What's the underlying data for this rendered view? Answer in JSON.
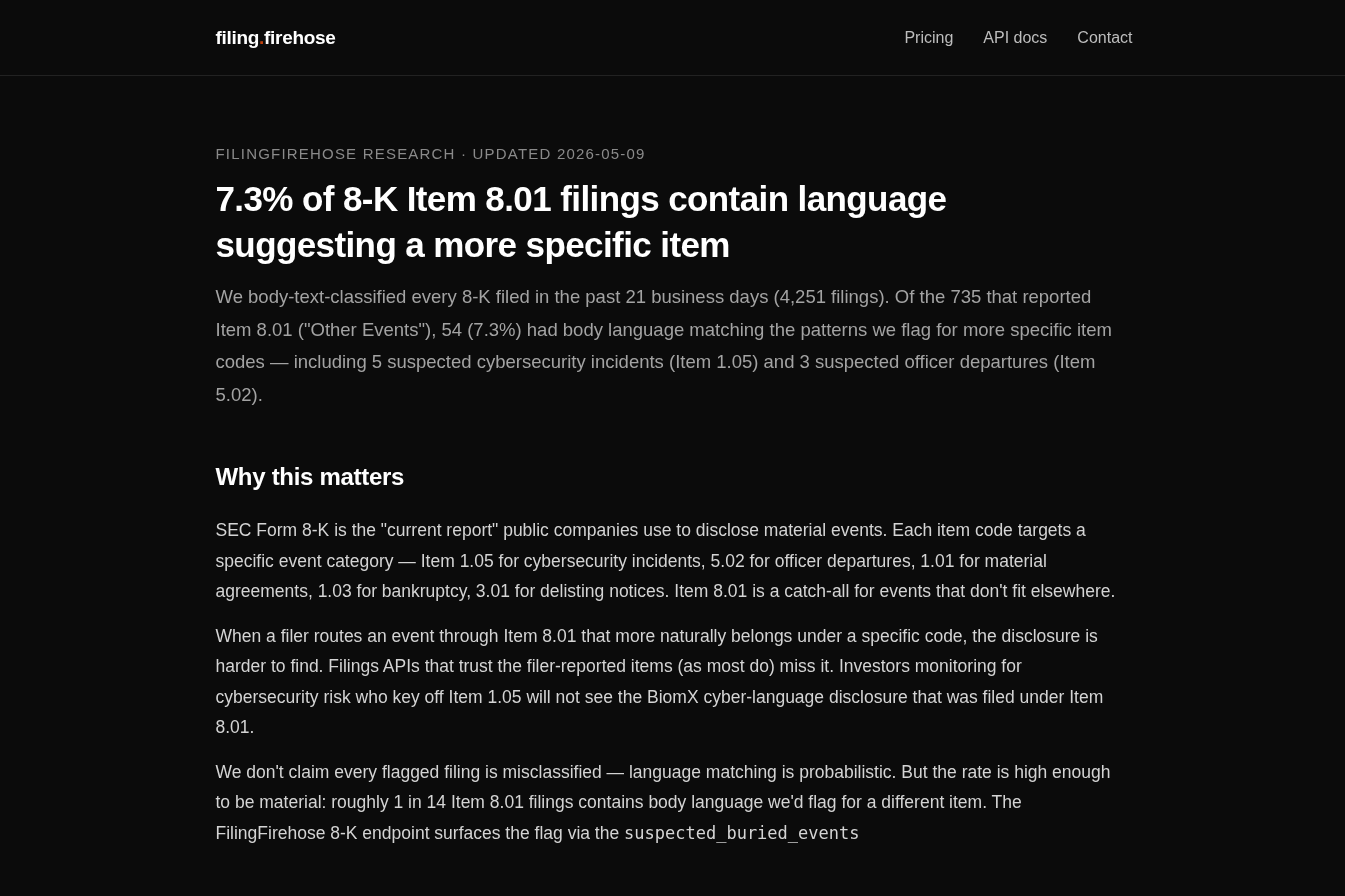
{
  "header": {
    "logo": {
      "first": "filing",
      "dot": ".",
      "last": "firehose"
    },
    "nav": [
      "Pricing",
      "API docs",
      "Contact"
    ]
  },
  "article": {
    "meta": "FILINGFIREHOSE RESEARCH · UPDATED 2026-05-09",
    "title": "7.3% of 8-K Item 8.01 filings contain language suggesting a more specific item",
    "lede": "We body-text-classified every 8-K filed in the past 21 business days (4,251 filings). Of the 735 that reported Item 8.01 (\"Other Events\"), 54 (7.3%) had body language matching the patterns we flag for more specific item codes — including 5 suspected cybersecurity incidents (Item 1.05) and 3 suspected officer departures (Item 5.02).",
    "section_heading": "Why this matters",
    "paragraphs": [
      [
        {
          "kind": "text",
          "text": "SEC Form 8-K is the \"current report\" public companies use to disclose material events. Each item code targets a specific event category — Item 1.05 for cybersecurity incidents, 5.02 for officer departures, 1.01 for material agreements, 1.03 for bankruptcy, 3.01 for delisting notices. Item 8.01 is a catch-all for events that don't fit elsewhere."
        }
      ],
      [
        {
          "kind": "text",
          "text": "When a filer routes an event through Item 8.01 that more naturally belongs under a specific code, the disclosure is harder to find. Filings APIs that trust the filer-reported items (as most do) miss it. Investors monitoring for cybersecurity risk who key off Item 1.05 will not see the BiomX cyber-language disclosure that was filed under Item 8.01."
        }
      ],
      [
        {
          "kind": "text",
          "text": "We don't claim every flagged filing is misclassified — language matching is probabilistic. But the rate is high enough to be material: roughly 1 in 14 Item 8.01 filings contains body language we'd flag for a different item. The FilingFirehose 8-K endpoint surfaces the flag via the "
        },
        {
          "kind": "code",
          "text": "suspected_buried_events"
        }
      ]
    ]
  }
}
